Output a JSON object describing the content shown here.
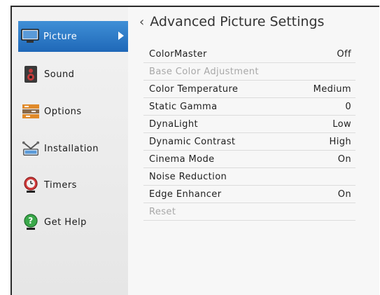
{
  "sidebar": {
    "items": [
      {
        "label": "Picture",
        "icon": "picture-icon",
        "selected": true
      },
      {
        "label": "Sound",
        "icon": "speaker-icon"
      },
      {
        "label": "Options",
        "icon": "options-icon"
      },
      {
        "label": "Installation",
        "icon": "antenna-icon"
      },
      {
        "label": "Timers",
        "icon": "timer-icon"
      },
      {
        "label": "Get Help",
        "icon": "help-icon"
      }
    ]
  },
  "main": {
    "title": "Advanced Picture Settings",
    "settings": [
      {
        "label": "ColorMaster",
        "value": "Off",
        "enabled": true
      },
      {
        "label": "Base Color Adjustment",
        "value": "",
        "enabled": false
      },
      {
        "label": "Color Temperature",
        "value": "Medium",
        "enabled": true
      },
      {
        "label": "Static Gamma",
        "value": "0",
        "enabled": true
      },
      {
        "label": "DynaLight",
        "value": "Low",
        "enabled": true
      },
      {
        "label": "Dynamic Contrast",
        "value": "High",
        "enabled": true
      },
      {
        "label": "Cinema Mode",
        "value": "On",
        "enabled": true
      },
      {
        "label": "Noise Reduction",
        "value": "",
        "enabled": true
      },
      {
        "label": "Edge Enhancer",
        "value": "On",
        "enabled": true
      },
      {
        "label": "Reset",
        "value": "",
        "enabled": false
      }
    ]
  },
  "colors": {
    "selection": "#2a78c8",
    "disabled_text": "#a8a8a8"
  }
}
